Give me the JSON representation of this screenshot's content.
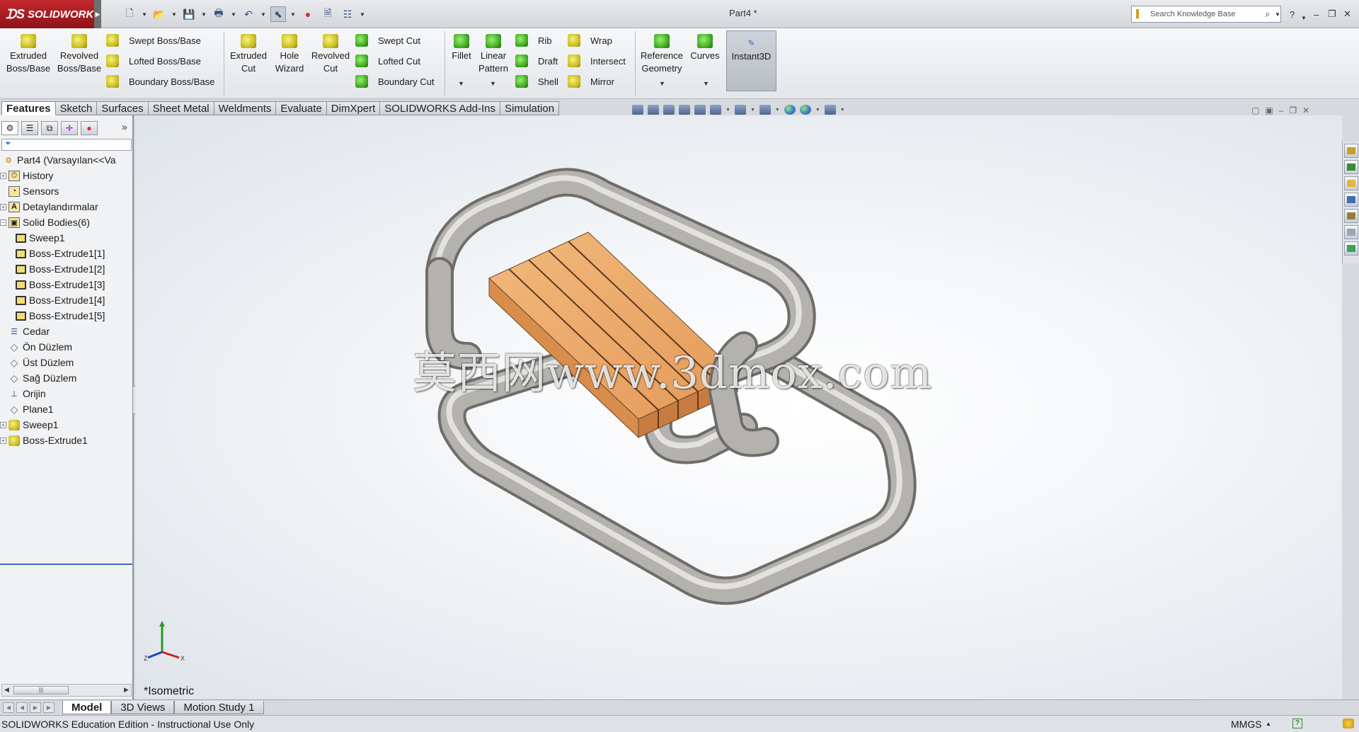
{
  "app": {
    "logo": "SOLIDWORKS",
    "doc_title": "Part4 *"
  },
  "search": {
    "placeholder": "Search Knowledge Base"
  },
  "ribbon": {
    "extruded_boss": "Extruded Boss/Base",
    "revolved_boss": "Revolved Boss/Base",
    "swept_boss": "Swept Boss/Base",
    "lofted_boss": "Lofted Boss/Base",
    "boundary_boss": "Boundary Boss/Base",
    "extruded_cut": "Extruded Cut",
    "hole_wizard": "Hole Wizard",
    "revolved_cut": "Revolved Cut",
    "swept_cut": "Swept Cut",
    "lofted_cut": "Lofted Cut",
    "boundary_cut": "Boundary Cut",
    "fillet": "Fillet",
    "linear_pattern": "Linear Pattern",
    "rib": "Rib",
    "draft": "Draft",
    "shell": "Shell",
    "wrap": "Wrap",
    "intersect": "Intersect",
    "mirror": "Mirror",
    "reference_geometry": "Reference Geometry",
    "curves": "Curves",
    "instant3d": "Instant3D"
  },
  "tabs": [
    "Features",
    "Sketch",
    "Surfaces",
    "Sheet Metal",
    "Weldments",
    "Evaluate",
    "DimXpert",
    "SOLIDWORKS Add-Ins",
    "Simulation"
  ],
  "tree": {
    "root": "Part4  (Varsayılan<<Va",
    "history": "History",
    "sensors": "Sensors",
    "annotations": "Detaylandırmalar",
    "solid_bodies": "Solid Bodies(6)",
    "bodies": [
      "Sweep1",
      "Boss-Extrude1[1]",
      "Boss-Extrude1[2]",
      "Boss-Extrude1[3]",
      "Boss-Extrude1[4]",
      "Boss-Extrude1[5]"
    ],
    "material": "Cedar",
    "front_plane": "Ön Düzlem",
    "top_plane": "Üst Düzlem",
    "right_plane": "Sağ Düzlem",
    "origin": "Orijin",
    "plane1": "Plane1",
    "sweep1": "Sweep1",
    "boss_extrude1": "Boss-Extrude1"
  },
  "viewport": {
    "view_name": "*Isometric",
    "watermark": "莫西网www.3dmox.com"
  },
  "bottom_tabs": [
    "Model",
    "3D Views",
    "Motion Study 1"
  ],
  "status": {
    "text": "SOLIDWORKS Education Edition - Instructional Use Only",
    "units": "MMGS"
  },
  "colors": {
    "brand": "#b3151a",
    "tube": "#a9a7a3",
    "wood": "#e8a468"
  }
}
